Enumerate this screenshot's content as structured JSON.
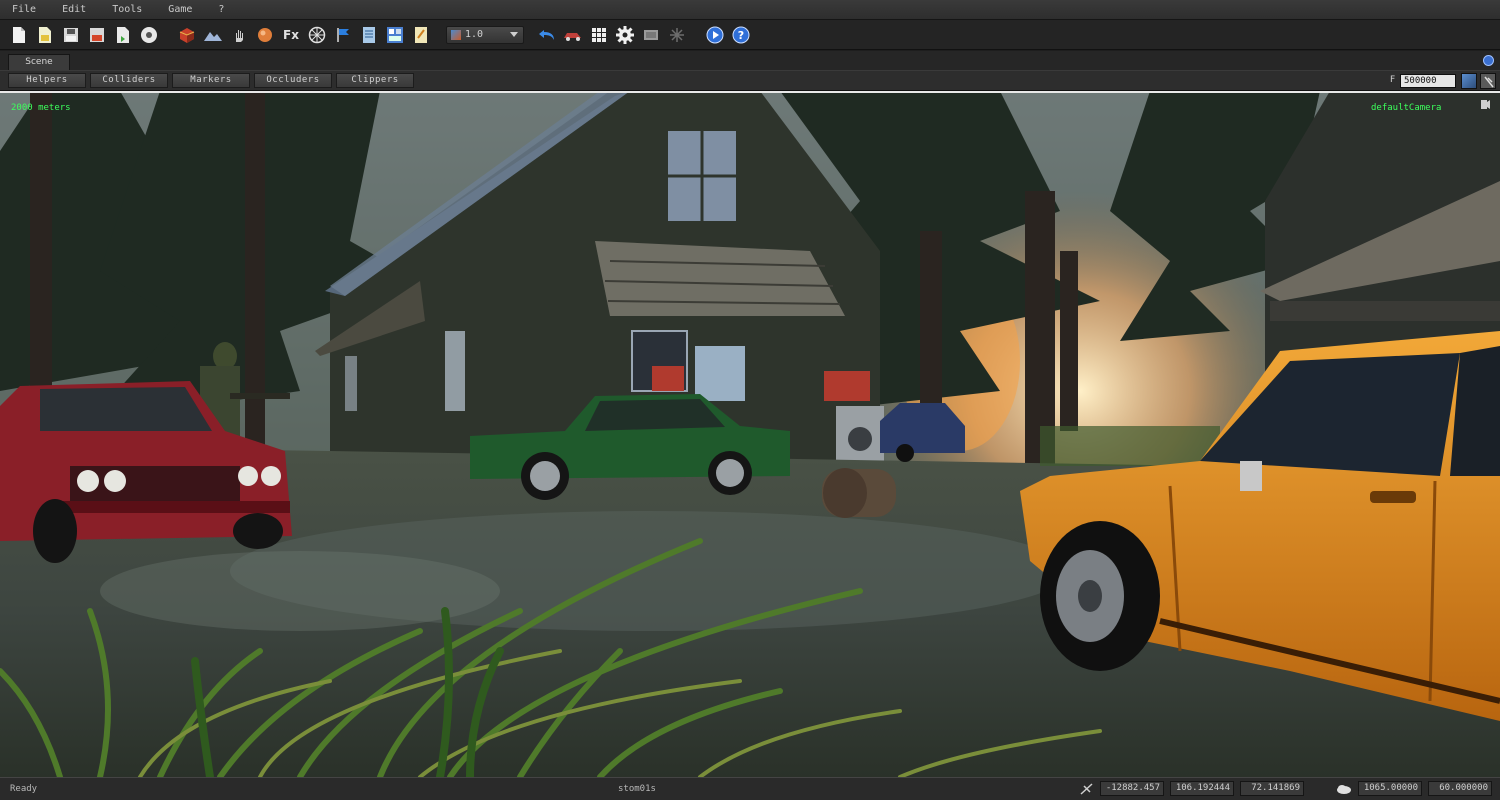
{
  "menu": {
    "items": [
      "File",
      "Edit",
      "Tools",
      "Game",
      "?"
    ]
  },
  "toolbar": {
    "icons": [
      "new-file-icon",
      "open-file-icon",
      "save-icon",
      "save-as-icon",
      "export-icon",
      "disc-icon",
      "cube-icon",
      "terrain-icon",
      "hand-icon",
      "sphere-icon",
      "fx-icon",
      "compass-icon",
      "flag-icon",
      "document-icon",
      "layout-icon",
      "notes-icon",
      "undo-icon",
      "vehicle-icon",
      "grid-icon",
      "settings-gear-icon",
      "keyboard-icon",
      "snowflake-icon",
      "play-icon",
      "help-icon"
    ],
    "fx_label": "Fx",
    "zoom_value": "1.0"
  },
  "tabs": {
    "scene_label": "Scene"
  },
  "filters": {
    "buttons": [
      "Helpers",
      "Colliders",
      "Markers",
      "Occluders",
      "Clippers"
    ],
    "far_label": "F",
    "far_value": "500000"
  },
  "viewport": {
    "distance_readout": "2000 meters",
    "camera_name": "defaultCamera"
  },
  "status": {
    "text": "Ready",
    "map_name": "stom01s",
    "coord_x": "-12882.457",
    "coord_y": "106.192444",
    "coord_z": "72.141869",
    "value_a": "1065.00000",
    "value_b": "60.000000"
  },
  "colors": {
    "overlay_green": "#3cff5c",
    "red_car": "#8a1f28",
    "green_car": "#1f5a2c",
    "orange_car": "#e0901e"
  }
}
